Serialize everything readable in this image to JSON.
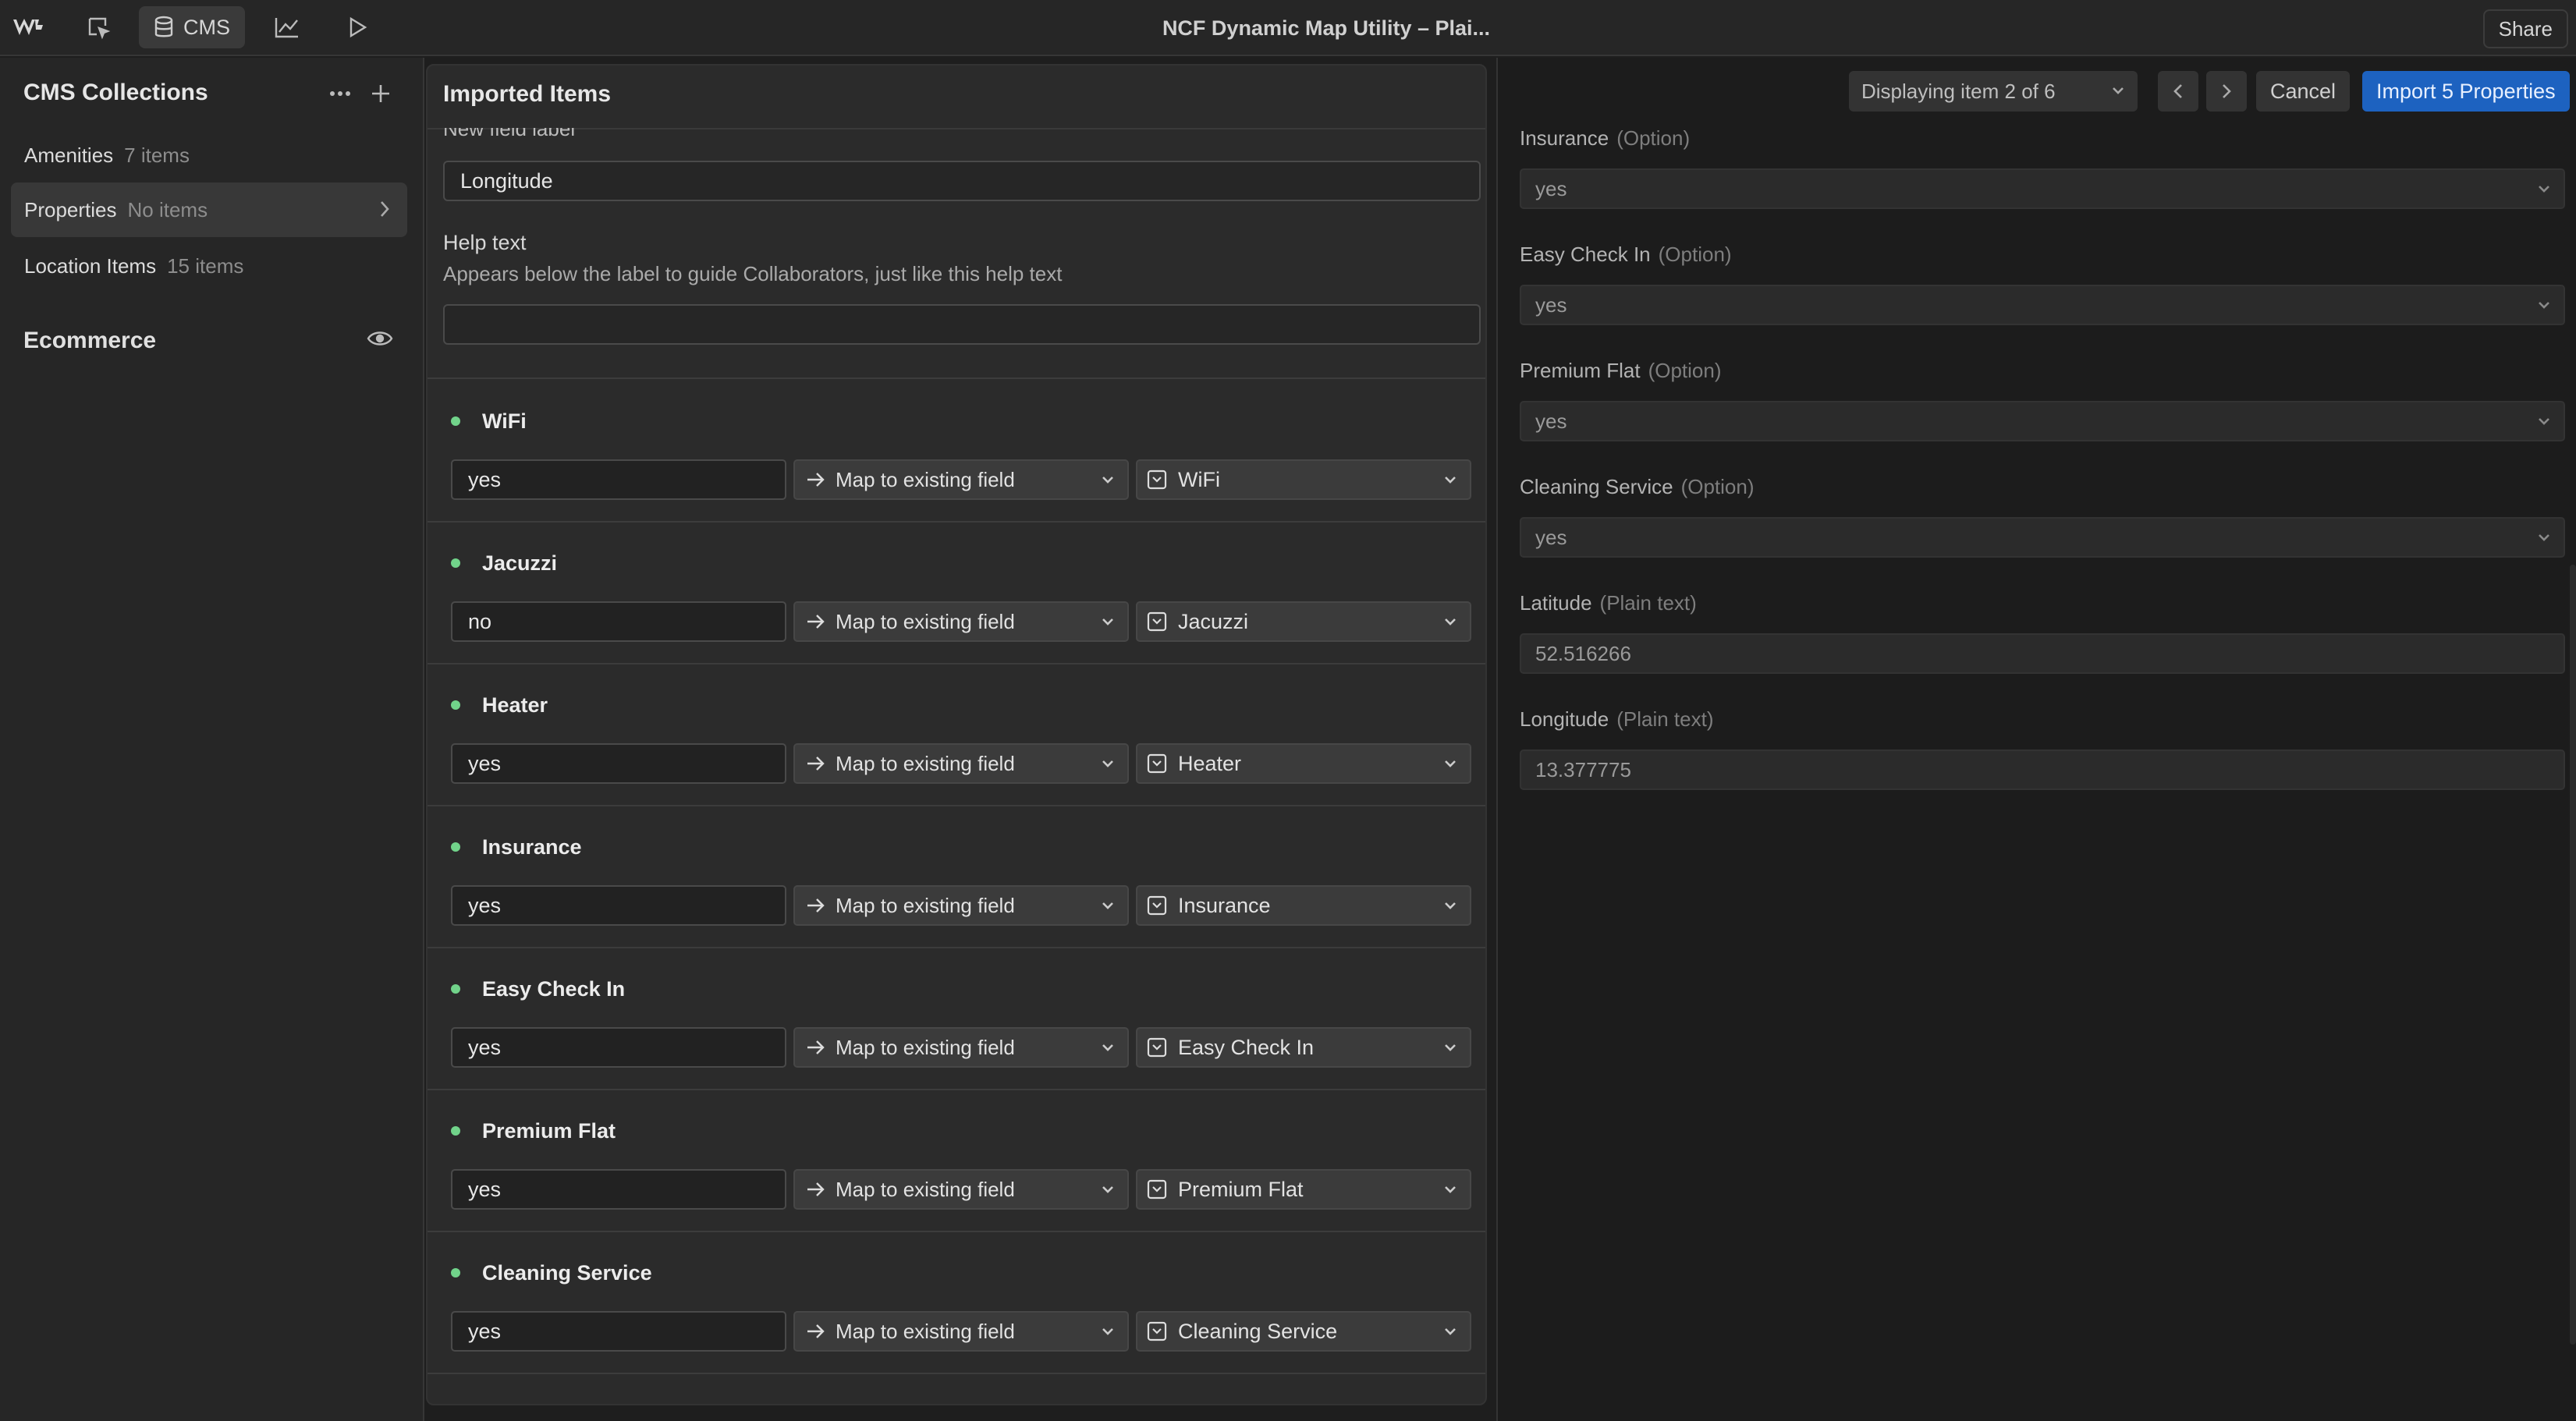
{
  "topbar": {
    "cms_label": "CMS",
    "title": "NCF Dynamic Map Utility – Plai...",
    "share_label": "Share"
  },
  "sidebar": {
    "heading": "CMS Collections",
    "collections": [
      {
        "name": "Amenities",
        "count": "7 items"
      },
      {
        "name": "Properties",
        "count": "No items"
      },
      {
        "name": "Location Items",
        "count": "15 items"
      }
    ],
    "ecommerce_label": "Ecommerce"
  },
  "modal": {
    "title": "Imported Items",
    "new_field_label": "New field label",
    "new_field_value": "Longitude",
    "help_text_label": "Help text",
    "help_text_desc": "Appears below the label to guide Collaborators, just like this help text",
    "help_text_value": "",
    "map_option_label": "Map to existing field",
    "rows": [
      {
        "name": "WiFi",
        "value": "yes",
        "field": "WiFi"
      },
      {
        "name": "Jacuzzi",
        "value": "no",
        "field": "Jacuzzi"
      },
      {
        "name": "Heater",
        "value": "yes",
        "field": "Heater"
      },
      {
        "name": "Insurance",
        "value": "yes",
        "field": "Insurance"
      },
      {
        "name": "Easy Check In",
        "value": "yes",
        "field": "Easy Check In"
      },
      {
        "name": "Premium Flat",
        "value": "yes",
        "field": "Premium Flat"
      },
      {
        "name": "Cleaning Service",
        "value": "yes",
        "field": "Cleaning Service"
      }
    ]
  },
  "preview": {
    "displaying": "Displaying item 2 of 6",
    "cancel_label": "Cancel",
    "import_label": "Import 5 Properties",
    "fields": [
      {
        "label": "Insurance",
        "type": "(Option)",
        "value": "yes"
      },
      {
        "label": "Easy Check In",
        "type": "(Option)",
        "value": "yes"
      },
      {
        "label": "Premium Flat",
        "type": "(Option)",
        "value": "yes"
      },
      {
        "label": "Cleaning Service",
        "type": "(Option)",
        "value": "yes"
      },
      {
        "label": "Latitude",
        "type": "(Plain text)",
        "value": "52.516266"
      },
      {
        "label": "Longitude",
        "type": "(Plain text)",
        "value": "13.377775"
      }
    ]
  }
}
